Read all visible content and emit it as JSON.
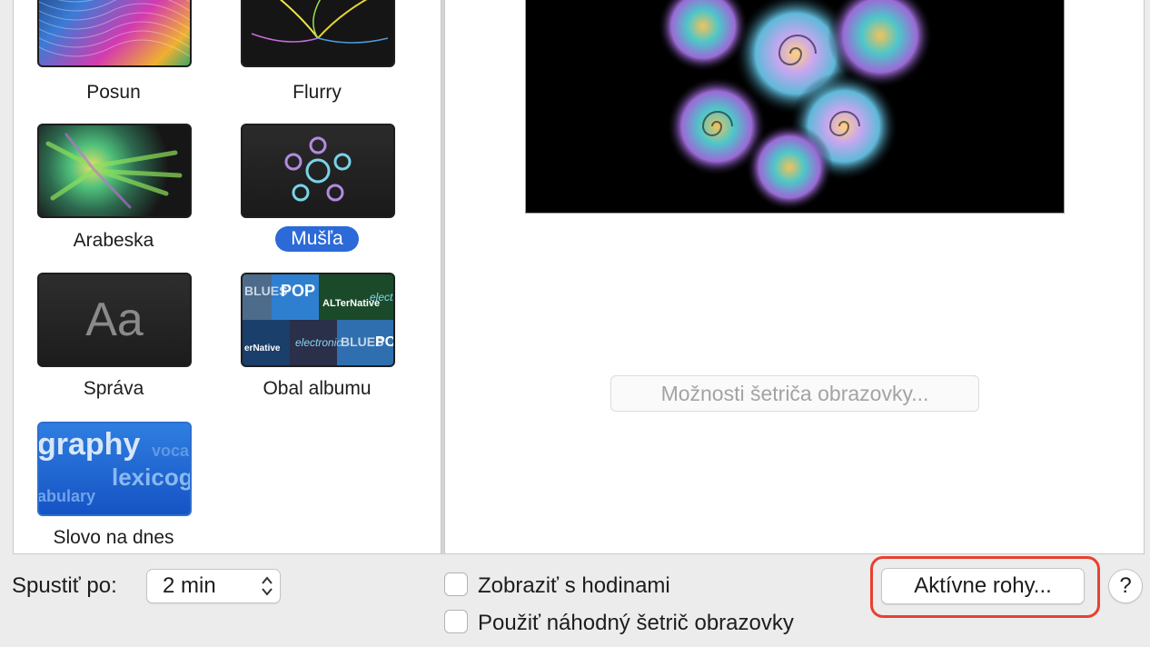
{
  "screensavers": [
    {
      "name": "Posun",
      "selected": false
    },
    {
      "name": "Flurry",
      "selected": false
    },
    {
      "name": "Arabeska",
      "selected": false
    },
    {
      "name": "Mušľa",
      "selected": true
    },
    {
      "name": "Správa",
      "selected": false,
      "thumb_text": "Aa"
    },
    {
      "name": "Obal albumu",
      "selected": false,
      "thumb_words": [
        "BLUES",
        "POP",
        "ALTerNative",
        "electr",
        "erNative",
        "electronic",
        "BLUES",
        "PO"
      ]
    },
    {
      "name": "Slovo na dnes",
      "selected": false,
      "thumb_words": [
        "graphy",
        "voca",
        "lexicog",
        "abulary"
      ]
    }
  ],
  "options_button": "Možnosti šetriča obrazovky...",
  "start_after": {
    "label": "Spustiť po:",
    "value": "2 min"
  },
  "checkboxes": {
    "show_clock": {
      "label": "Zobraziť s hodinami",
      "checked": false
    },
    "random": {
      "label": "Použiť náhodný šetrič obrazovky",
      "checked": false
    }
  },
  "hot_corners_button": "Aktívne rohy...",
  "help_button": "?",
  "colors": {
    "accent": "#2c6ad8",
    "highlight": "#e8412f"
  }
}
